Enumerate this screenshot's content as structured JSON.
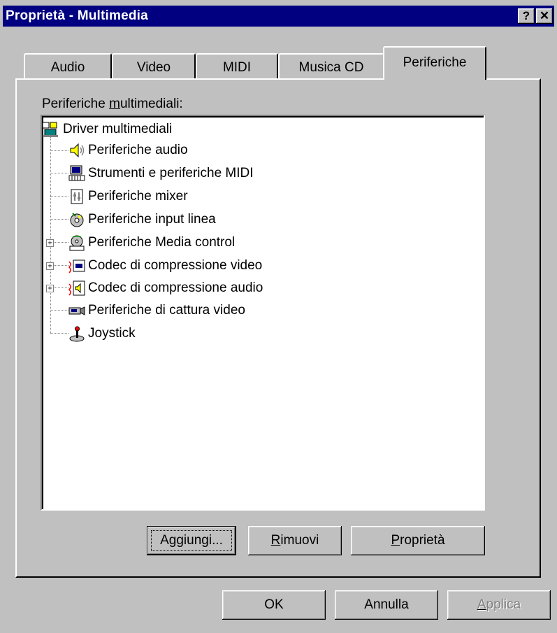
{
  "window": {
    "title": "Proprietà - Multimedia",
    "help_button": "?",
    "close_button": "✕"
  },
  "tabs": [
    {
      "label": "Audio",
      "active": false
    },
    {
      "label": "Video",
      "active": false
    },
    {
      "label": "MIDI",
      "active": false
    },
    {
      "label": "Musica CD",
      "active": false
    },
    {
      "label": "Periferiche",
      "active": true
    }
  ],
  "devices": {
    "label_prefix": "Periferiche ",
    "label_underlined": "m",
    "label_suffix": "ultimediali:",
    "root": {
      "label": "Driver multimediali",
      "icon": "multimedia-drivers-icon"
    },
    "items": [
      {
        "label": "Periferiche audio",
        "icon": "speaker-icon",
        "expandable": false
      },
      {
        "label": "Strumenti e periferiche MIDI",
        "icon": "midi-keyboard-icon",
        "expandable": false
      },
      {
        "label": "Periferiche mixer",
        "icon": "mixer-icon",
        "expandable": false
      },
      {
        "label": "Periferiche input linea",
        "icon": "line-input-icon",
        "expandable": false
      },
      {
        "label": "Periferiche Media control",
        "icon": "media-control-icon",
        "expandable": true
      },
      {
        "label": "Codec di compressione video",
        "icon": "video-codec-icon",
        "expandable": true
      },
      {
        "label": "Codec di compressione audio",
        "icon": "audio-codec-icon",
        "expandable": true
      },
      {
        "label": "Periferiche di cattura video",
        "icon": "video-capture-icon",
        "expandable": false
      },
      {
        "label": "Joystick",
        "icon": "joystick-icon",
        "expandable": false
      }
    ]
  },
  "panel_buttons": {
    "add": {
      "pre": "A",
      "u": "g",
      "post": "giungi..."
    },
    "remove": {
      "pre": "",
      "u": "R",
      "post": "imuovi"
    },
    "properties": {
      "pre": "",
      "u": "P",
      "post": "roprietà"
    }
  },
  "dialog_buttons": {
    "ok": "OK",
    "cancel": "Annulla",
    "apply": {
      "pre": "",
      "u": "A",
      "post": "pplica",
      "disabled": true
    }
  },
  "colors": {
    "titlebar": "#000080",
    "face": "#c0c0c0",
    "selection": "#000080"
  }
}
